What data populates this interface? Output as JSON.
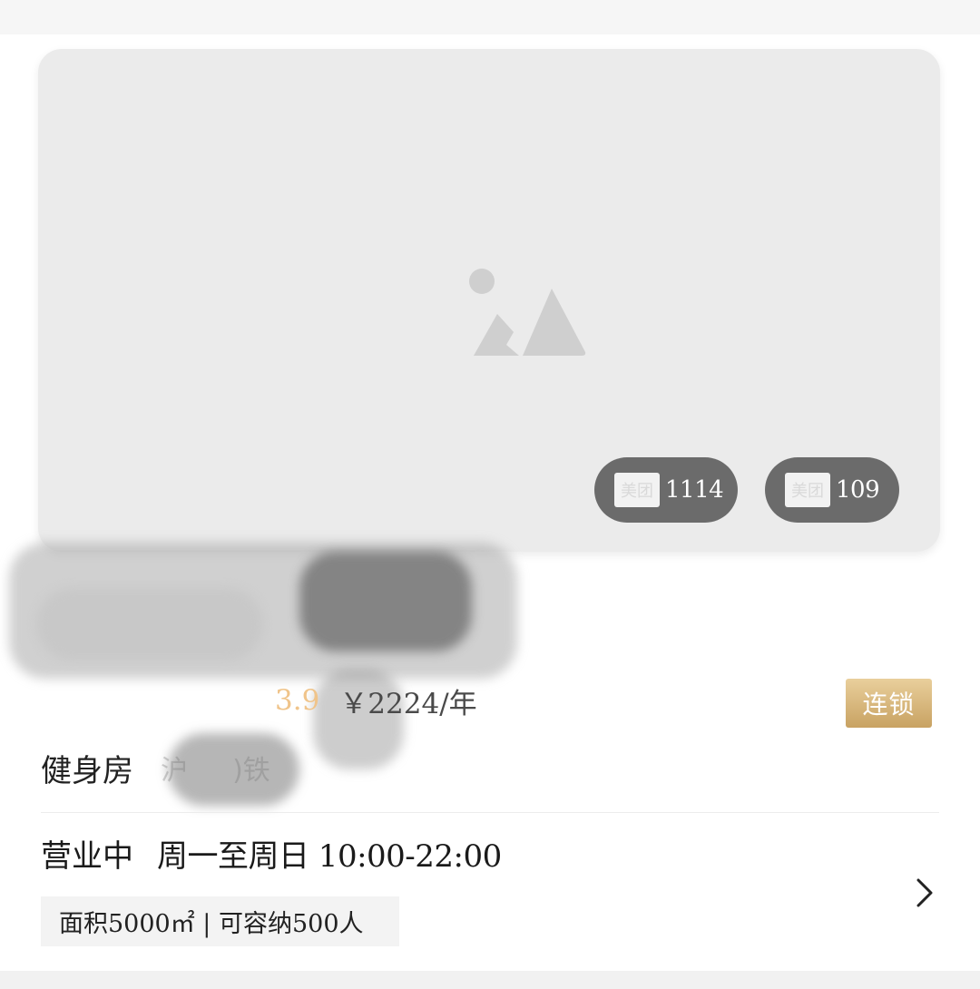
{
  "hero": {
    "placeholder_icon": "image-placeholder-icon",
    "badges": [
      {
        "logo": "美团",
        "count": "1114"
      },
      {
        "logo": "美团",
        "count": "109"
      }
    ]
  },
  "price_row": {
    "rating": "3.9",
    "annual_price": "￥2224/年"
  },
  "chain_badge": "连锁",
  "category": {
    "label": "健身房",
    "address_partial": "沪 　 )铁"
  },
  "hours": {
    "status": "营业中",
    "schedule": "周一至周日 10:00-22:00"
  },
  "info_tag": "面积5000㎡ | 可容纳500人",
  "icons": {
    "chevron": "chevron-right-icon"
  },
  "colors": {
    "badge_gold_top": "#e9cf9c",
    "badge_gold_bottom": "#c8a262",
    "rating": "#f0c48a",
    "pill_bg": "#6b6b6b"
  }
}
